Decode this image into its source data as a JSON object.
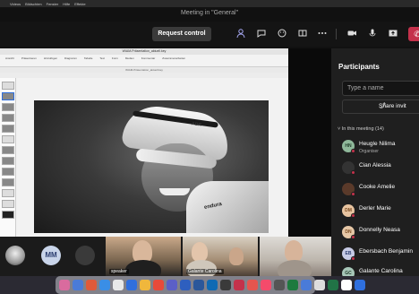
{
  "menubar": {
    "items": [
      "Videos",
      "Bildschirm",
      "Fenster",
      "Hilfe",
      "Effekte",
      "Ablage"
    ]
  },
  "window": {
    "title": "Meeting in \"General\""
  },
  "toolbar": {
    "request_control_label": "Request control",
    "icons": [
      "people-icon",
      "chat-icon",
      "reactions-icon",
      "rooms-icon",
      "more-icon",
      "camera-icon",
      "mic-icon",
      "share-icon",
      "leave-icon"
    ]
  },
  "shared_screen": {
    "file_title": "WIAM-Präsentation_aktuell.key",
    "ribbon_items": [
      "Ansicht",
      "Präsentieren",
      "Hinzufügen",
      "Diagramm",
      "Tabelle",
      "Text",
      "Form",
      "Medien",
      "Kommentar",
      "Zusammenarbeiten"
    ],
    "slide_text_helmet": "ABR",
    "slide_text_jersey": "endura"
  },
  "participants_strip": {
    "initials_tile": "MM",
    "tiles": [
      {
        "label": "speaker"
      },
      {
        "label": "Galante Carolina"
      },
      {
        "label": ""
      }
    ]
  },
  "panel": {
    "title": "Participants",
    "search_placeholder": "Type a name",
    "share_invite_label": "Share invit",
    "section_label": "In this meeting (14)",
    "participants": [
      {
        "initials": "HN",
        "name": "Heugle Nilima",
        "role": "Organiser",
        "color": "#8fb89a"
      },
      {
        "initials": "CA",
        "name": "Cian Alessia",
        "role": "",
        "color": "#333333"
      },
      {
        "initials": "CA",
        "name": "Cooke Amelie",
        "role": "",
        "color": "#5a3a2a"
      },
      {
        "initials": "DM",
        "name": "Derler Marie",
        "role": "",
        "color": "#e8c4a0"
      },
      {
        "initials": "DN",
        "name": "Donnelly Neasa",
        "role": "",
        "color": "#e6c7a6"
      },
      {
        "initials": "EB",
        "name": "Ebersbach Benjamin",
        "role": "",
        "color": "#c7cbe6"
      },
      {
        "initials": "GC",
        "name": "Galante Carolina",
        "role": "",
        "color": "#a7c7b8"
      }
    ]
  },
  "colors": {
    "leave": "#c4314b",
    "accent": "#a9abf7",
    "panel_bg": "#1f1f1f"
  }
}
